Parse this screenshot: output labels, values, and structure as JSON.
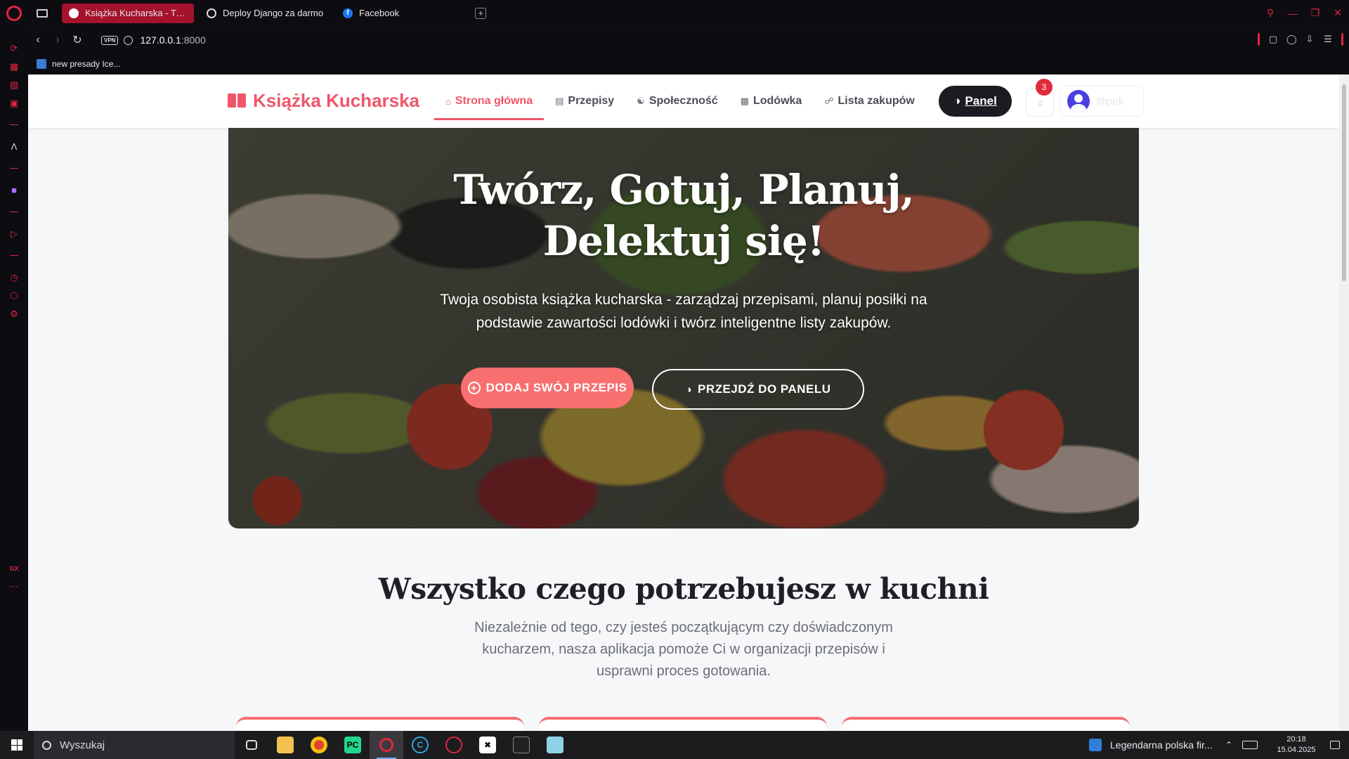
{
  "browser": {
    "tabs": [
      {
        "label": "Książka Kucharska - Twoja",
        "icon": "globe-icon",
        "active": true
      },
      {
        "label": "Deploy Django za darmo",
        "icon": "globe-icon",
        "active": false
      },
      {
        "label": "Facebook",
        "icon": "facebook-icon",
        "active": false
      }
    ],
    "url_host": "127.0.0.1",
    "url_port": ":8000",
    "vpn_label": "VPN",
    "bookmark": "new presady Ice...",
    "accent": "#e2253f"
  },
  "navbar": {
    "brand": "Książka Kucharska",
    "links": [
      {
        "label": "Strona główna",
        "icon": "home-icon",
        "active": true
      },
      {
        "label": "Przepisy",
        "icon": "book-icon",
        "active": false
      },
      {
        "label": "Społeczność",
        "icon": "people-icon",
        "active": false
      },
      {
        "label": "Lodówka",
        "icon": "basket-icon",
        "active": false
      },
      {
        "label": "Lista zakupów",
        "icon": "cart-icon",
        "active": false
      }
    ],
    "panel_label": "Panel",
    "notification_count": "3",
    "username": "filipek"
  },
  "hero": {
    "title_line1": "Twórz, Gotuj, Planuj,",
    "title_line2": "Delektuj się!",
    "subtitle": "Twoja osobista książka kucharska - zarządzaj przepisami, planuj posiłki na podstawie zawartości lodówki i twórz inteligentne listy zakupów.",
    "btn_add": "DODAJ SWÓJ PRZEPIS",
    "btn_panel": "PRZEJDŹ DO PANELU"
  },
  "features": {
    "title": "Wszystko czego potrzebujesz w kuchni",
    "subtitle": "Niezależnie od tego, czy jesteś początkującym czy doświadczonym kucharzem, nasza aplikacja pomoże Ci w organizacji przepisów i usprawni proces gotowania."
  },
  "taskbar": {
    "search_placeholder": "Wyszukaj",
    "news": "Legendarna polska fir...",
    "time": "20:18",
    "date": "15.04.2025"
  },
  "colors": {
    "brand": "#f0566a",
    "button": "#f76f6f",
    "dark": "#1a1c22"
  }
}
